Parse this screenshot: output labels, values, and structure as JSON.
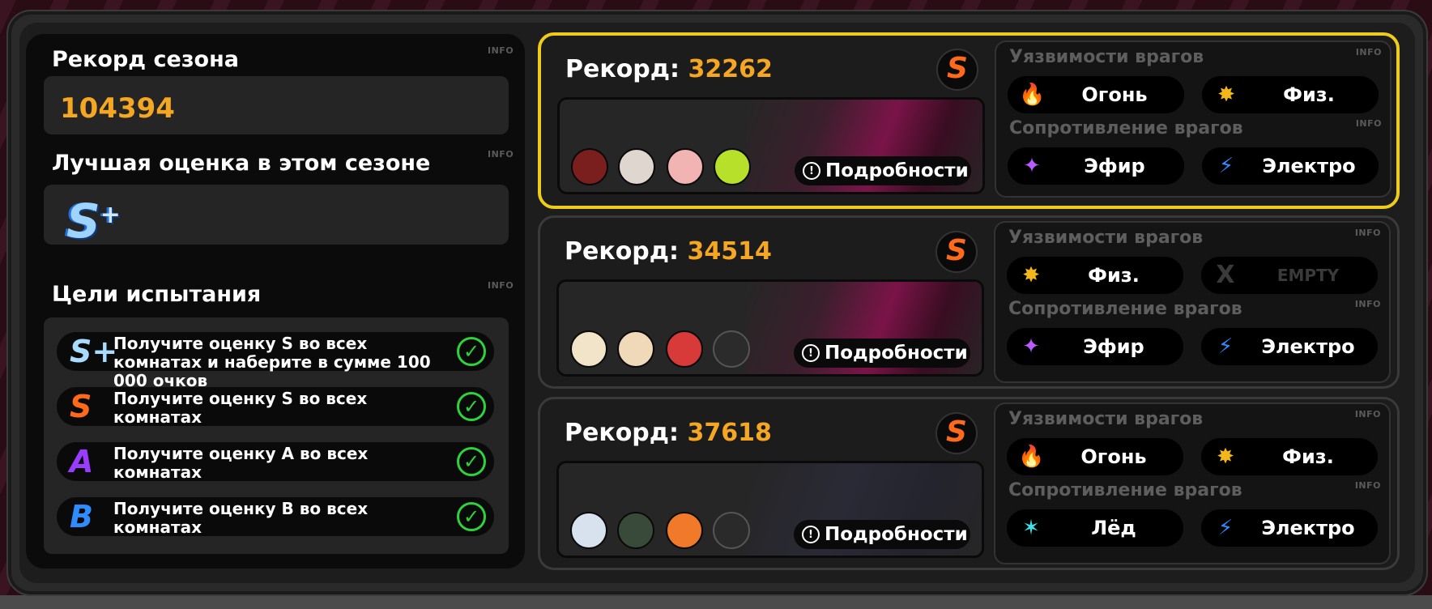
{
  "left": {
    "season_record_title": "Рекорд сезона",
    "season_record_value": "104394",
    "best_grade_title": "Лучшая оценка в этом сезоне",
    "best_grade": "S",
    "best_grade_plus": "+",
    "goals_title": "Цели испытания",
    "info_label": "INFO",
    "goals": [
      {
        "grade": "S+",
        "text": "Получите оценку S во всех комнатах и наберите в сумме 100 000 очков",
        "done": true
      },
      {
        "grade": "S",
        "text": "Получите оценку S во всех комнатах",
        "done": true
      },
      {
        "grade": "A",
        "text": "Получите оценку A во всех комнатах",
        "done": true
      },
      {
        "grade": "B",
        "text": "Получите оценку B во всех комнатах",
        "done": true
      }
    ]
  },
  "cards": [
    {
      "record_label": "Рекорд:",
      "record_value": "32262",
      "rank": "S",
      "details_label": "Подробности",
      "weakness_title": "Уязвимости врагов",
      "resistance_title": "Сопротивление врагов",
      "weaknesses": [
        {
          "icon": "fire-icon",
          "name": "Огонь"
        },
        {
          "icon": "physical-icon",
          "name": "Физ."
        }
      ],
      "resistances": [
        {
          "icon": "ether-icon",
          "name": "Эфир"
        },
        {
          "icon": "electric-icon",
          "name": "Электро"
        }
      ],
      "avatar_colors": [
        "#7a1e1e",
        "#e0d6d0",
        "#f2b3b3",
        "#b6e02a"
      ]
    },
    {
      "record_label": "Рекорд:",
      "record_value": "34514",
      "rank": "S",
      "details_label": "Подробности",
      "weakness_title": "Уязвимости врагов",
      "resistance_title": "Сопротивление врагов",
      "weaknesses": [
        {
          "icon": "physical-icon",
          "name": "Физ."
        },
        {
          "icon": "empty-icon",
          "name": "EMPTY"
        }
      ],
      "resistances": [
        {
          "icon": "ether-icon",
          "name": "Эфир"
        },
        {
          "icon": "electric-icon",
          "name": "Электро"
        }
      ],
      "avatar_colors": [
        "#f1e4c8",
        "#f0d9b8",
        "#d83a3a",
        "#2b2b2b"
      ]
    },
    {
      "record_label": "Рекорд:",
      "record_value": "37618",
      "rank": "S",
      "details_label": "Подробности",
      "weakness_title": "Уязвимости врагов",
      "resistance_title": "Сопротивление врагов",
      "weaknesses": [
        {
          "icon": "fire-icon",
          "name": "Огонь"
        },
        {
          "icon": "physical-icon",
          "name": "Физ."
        }
      ],
      "resistances": [
        {
          "icon": "ice-icon",
          "name": "Лёд"
        },
        {
          "icon": "electric-icon",
          "name": "Электро"
        }
      ],
      "avatar_colors": [
        "#d8e2ee",
        "#3a4a3a",
        "#f07a2a",
        "#2a2a2a"
      ]
    }
  ],
  "colors": {
    "accent_orange": "#f5a623",
    "active_border": "#f0cc1a",
    "check_green": "#2fd23a"
  }
}
